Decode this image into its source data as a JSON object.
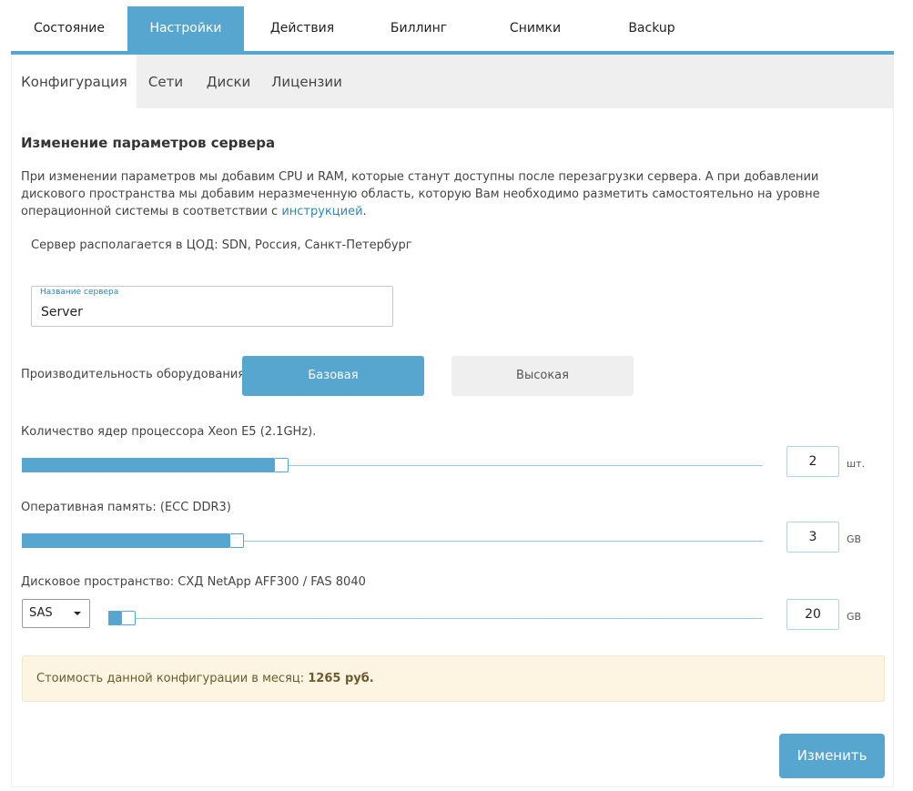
{
  "top_tabs": [
    {
      "label": "Состояние"
    },
    {
      "label": "Настройки"
    },
    {
      "label": "Действия"
    },
    {
      "label": "Биллинг"
    },
    {
      "label": "Снимки"
    },
    {
      "label": "Backup"
    }
  ],
  "active_top_tab": "Настройки",
  "sub_tabs": [
    {
      "label": "Конфигурация"
    },
    {
      "label": "Сети"
    },
    {
      "label": "Диски"
    },
    {
      "label": "Лицензии"
    }
  ],
  "active_sub_tab": "Конфигурация",
  "config": {
    "heading": "Изменение параметров сервера",
    "description_before_link": "При изменении параметров мы добавим CPU и RAM, которые станут доступны после перезагрузки сервера. А при добавлении дискового пространства мы добавим неразмеченную область, которую Вам необходимо разметить самостоятельно на уровне операционной системы в соответствии с ",
    "description_link": "инструкцией",
    "description_after_link": ".",
    "location": "Сервер располагается в ЦОД: SDN, Россия, Санкт-Петербург",
    "server_name_label": "Название сервера",
    "server_name_value": "Server",
    "performance_label": "Производительность оборудования",
    "performance_options": [
      "Базовая",
      "Высокая"
    ],
    "performance_selected": "Базовая",
    "cpu": {
      "label": "Количество ядер процессора Xeon E5 (2.1GHz).",
      "value": "2",
      "unit": "шт.",
      "level": 0.34
    },
    "ram": {
      "label": "Оперативная память: (ECC DDR3)",
      "value": "3",
      "unit": "GB",
      "level": 0.28
    },
    "disk": {
      "label": "Дисковое пространство: СХД NetApp AFF300 / FAS 8040",
      "type_selected": "SAS",
      "value": "20",
      "unit": "GB",
      "level": 0.02
    },
    "cost_label": "Стоимость данной конфигурации в месяц: ",
    "cost_value": "1265 руб.",
    "submit_label": "Изменить"
  },
  "colors": {
    "accent": "#57a6cf",
    "link": "#2f86b5",
    "cost_bg": "#fdf5e2"
  }
}
